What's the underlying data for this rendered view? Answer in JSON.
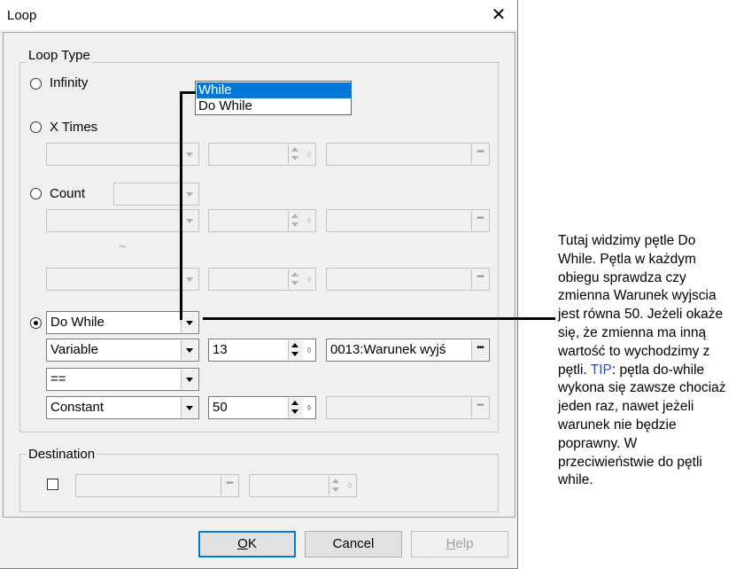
{
  "window": {
    "title": "Loop"
  },
  "loop_type": {
    "label": "Loop Type",
    "infinity": "Infinity",
    "x_times": "X Times",
    "count": "Count",
    "count_separator": "~",
    "do_while": {
      "selected": "Do While",
      "options": [
        "While",
        "Do While"
      ],
      "highlighted_option": "While",
      "operand_type": "Variable",
      "operand_number": "13",
      "operand_name": "0013:Warunek wyjś",
      "operator": "==",
      "compare_type": "Constant",
      "compare_value": "50"
    }
  },
  "destination": {
    "label": "Destination"
  },
  "buttons": {
    "ok": "OK",
    "cancel": "Cancel",
    "help": "Help"
  },
  "annotation": {
    "text_1": "Tutaj widzimy pętle Do While. Pętla w każdym obiegu sprawdza czy zmienna Warunek wyjscia jest równa 50. Jeżeli okaże się, że zmienna ma inną wartość to wychodzimy z pętli.",
    "tip_label": "TIP",
    "text_2": ": pętla do-while wykona się zawsze chociaż jeden raz, nawet jeżeli warunek nie będzie poprawny. W przeciwieństwie do pętli while."
  },
  "colors": {
    "highlight": "#0078d7",
    "tip": "#2b50c8",
    "dialog_bg": "#f0f0f0"
  }
}
